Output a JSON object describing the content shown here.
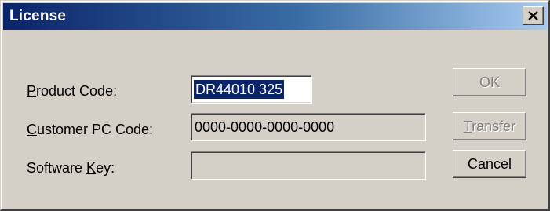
{
  "window": {
    "title": "License",
    "close_icon": "close-icon"
  },
  "form": {
    "product_code": {
      "label_mnemonic": "P",
      "label_rest": "roduct Code:",
      "value": "DR44010 325"
    },
    "customer_pc_code": {
      "label_mnemonic": "C",
      "label_rest": "ustomer PC Code:",
      "value": "0000-0000-0000-0000"
    },
    "software_key": {
      "label_before": "Software ",
      "label_mnemonic": "K",
      "label_rest": "ey:",
      "value": ""
    }
  },
  "buttons": {
    "ok": "OK",
    "transfer_mnemonic": "T",
    "transfer_rest": "ransfer",
    "cancel": "Cancel"
  },
  "colors": {
    "title_gradient_start": "#0a246a",
    "title_gradient_end": "#a6caf0",
    "face": "#d4d0c8",
    "selection": "#0a246a"
  }
}
